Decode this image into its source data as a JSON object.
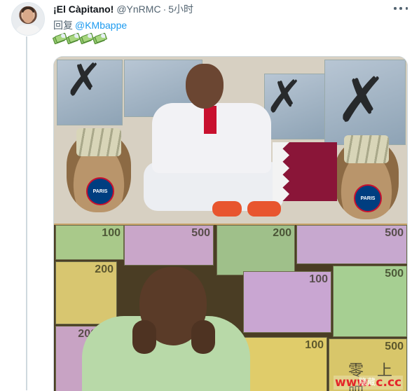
{
  "tweet": {
    "display_name": "¡El Càpitano!",
    "handle": "@YnRMC",
    "separator": "·",
    "time": "5小时",
    "reply_prefix": "回复",
    "reply_to": "@KMbappe",
    "emoji": [
      "money-with-wings",
      "money-with-wings",
      "money-with-wings",
      "money-with-wings"
    ]
  },
  "media": {
    "psg_label_left": "PARIS",
    "psg_label_right": "PARIS",
    "bill_labels": [
      "100",
      "500",
      "200",
      "500",
      "200",
      "100",
      "500",
      "200"
    ]
  },
  "watermark": {
    "cn_text": "零 上 吧",
    "site": "www.     c.cc",
    "hide_label": "隐藏"
  }
}
